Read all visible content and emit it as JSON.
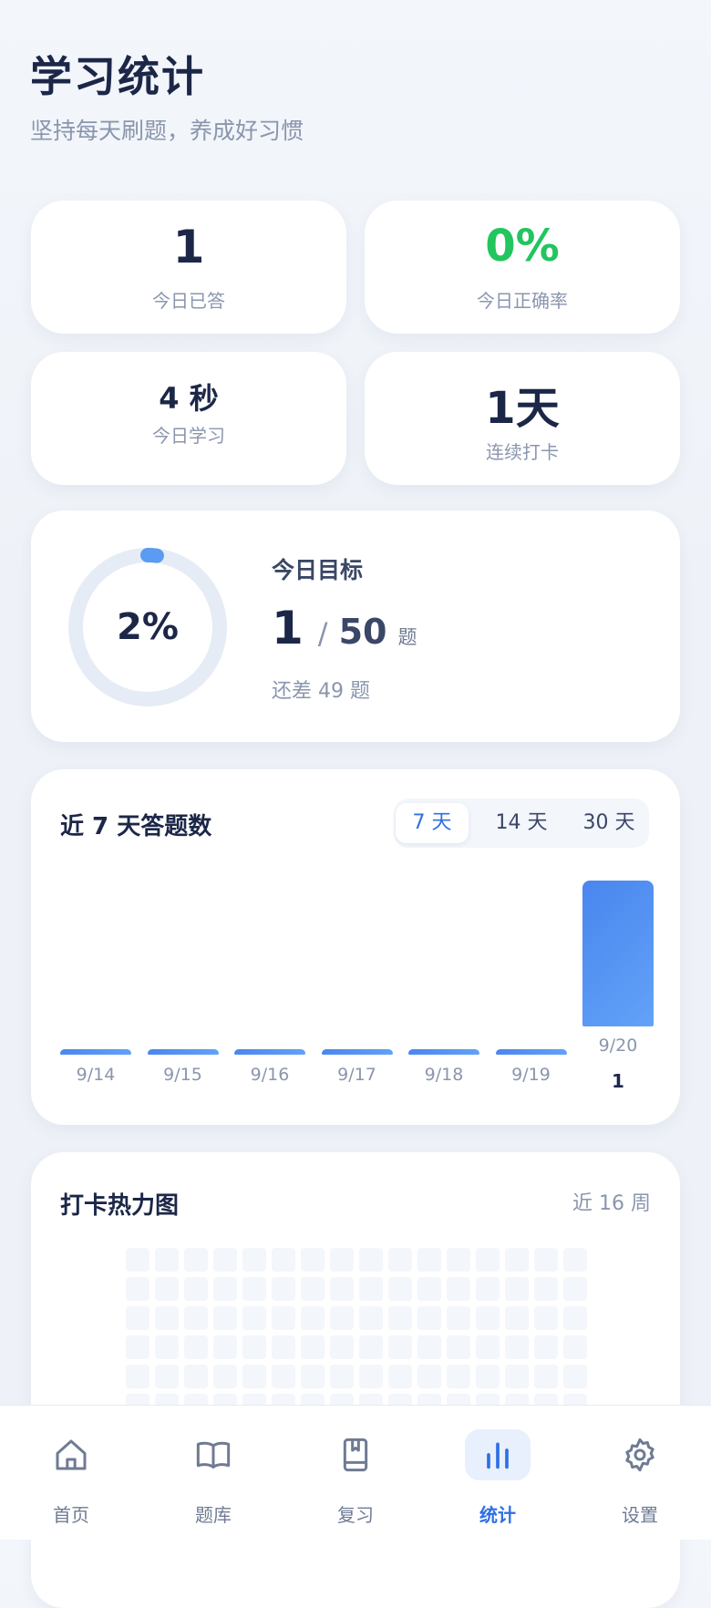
{
  "header": {
    "title": "学习统计",
    "subtitle": "坚持每天刷题，养成好习惯"
  },
  "stats": [
    {
      "value": "1",
      "label": "今日已答",
      "color": "#1c2748"
    },
    {
      "value": "0%",
      "label": "今日正确率",
      "color": "#22c55e"
    },
    {
      "value": "4 秒",
      "label": "今日学习",
      "color": "#1c2748"
    },
    {
      "value": "1天",
      "label": "连续打卡",
      "color": "#1c2748"
    }
  ],
  "goal": {
    "percent_label": "2%",
    "progress": 0.02,
    "title": "今日目标",
    "done": "1",
    "slash": "/",
    "total": "50",
    "unit": "题",
    "remaining": "还差 49 题"
  },
  "chart": {
    "title": "近 7 天答题数",
    "ranges": [
      "7 天",
      "14 天",
      "30 天"
    ],
    "active_range": 0
  },
  "chart_data": {
    "type": "bar",
    "categories": [
      "9/14",
      "9/15",
      "9/16",
      "9/17",
      "9/18",
      "9/19",
      "9/20"
    ],
    "values": [
      0,
      0,
      0,
      0,
      0,
      0,
      1
    ],
    "value_labels": [
      "",
      "",
      "",
      "",
      "",
      "",
      "1"
    ],
    "title": "近 7 天答题数",
    "xlabel": "",
    "ylabel": "",
    "ylim": [
      0,
      1
    ]
  },
  "heatmap": {
    "title": "打卡热力图",
    "subtitle": "近 16 周"
  },
  "tabs": [
    {
      "label": "首页",
      "icon": "home-icon"
    },
    {
      "label": "题库",
      "icon": "book-icon"
    },
    {
      "label": "复习",
      "icon": "bookmark-book-icon"
    },
    {
      "label": "统计",
      "icon": "bar-chart-icon",
      "active": true
    },
    {
      "label": "设置",
      "icon": "gear-icon"
    }
  ],
  "colors": {
    "accent": "#2f6fe4",
    "bar": "#4a86ee",
    "success": "#22c55e"
  }
}
